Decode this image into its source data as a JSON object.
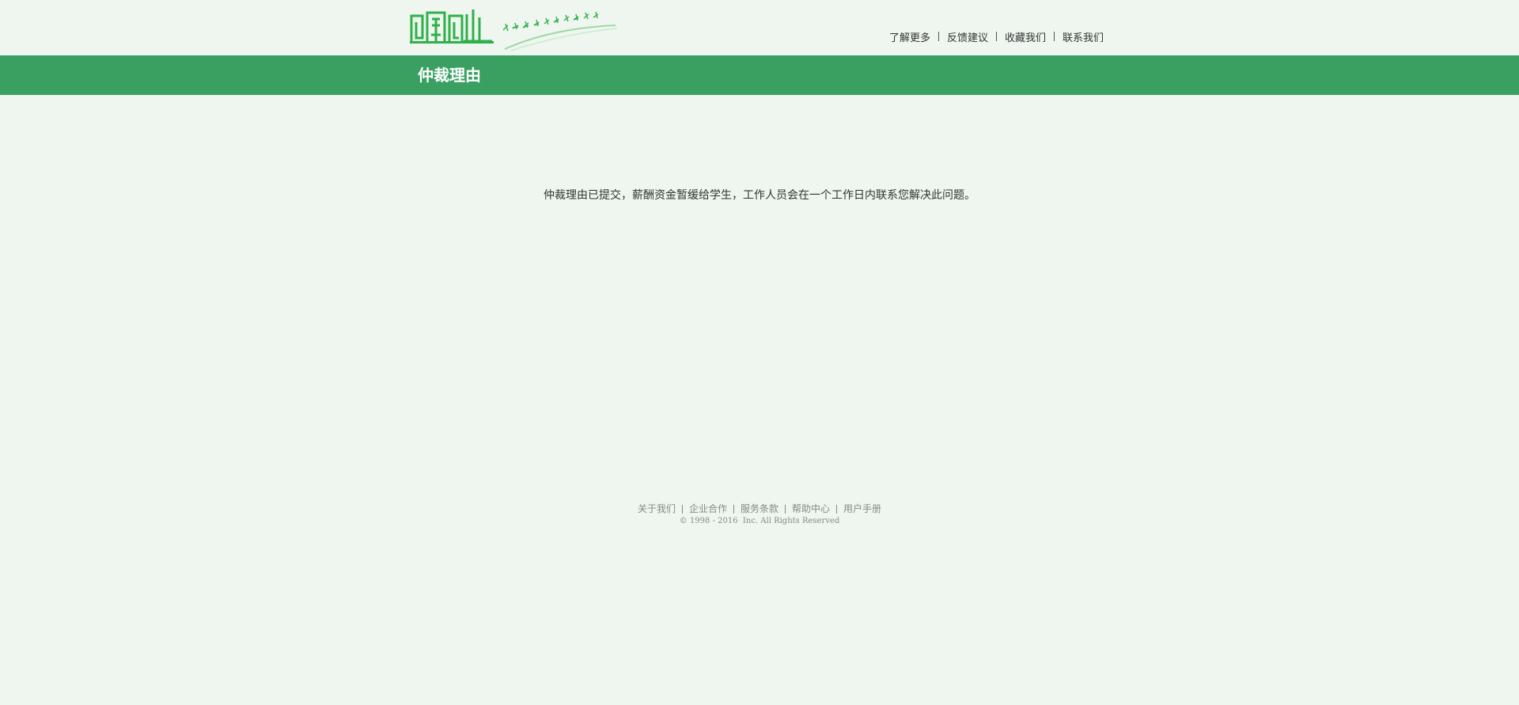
{
  "header": {
    "logo_alt": "logo",
    "nav": [
      {
        "label": "了解更多"
      },
      {
        "label": "反馈建议"
      },
      {
        "label": "收藏我们"
      },
      {
        "label": "联系我们"
      }
    ]
  },
  "title_bar": {
    "title": "仲裁理由"
  },
  "main": {
    "message": "仲裁理由已提交，薪酬资金暂缓给学生，工作人员会在一个工作日内联系您解决此问题。"
  },
  "footer": {
    "links": [
      {
        "label": "关于我们"
      },
      {
        "label": "企业合作"
      },
      {
        "label": "服务条款"
      },
      {
        "label": "帮助中心"
      },
      {
        "label": "用户手册"
      }
    ],
    "copyright": "© 1998 - 2016  Inc. All Rights Reserved"
  },
  "colors": {
    "page_bg": "#eef6ef",
    "title_bar_bg": "#39a062",
    "logo_green": "#2fb04a",
    "text": "#333333",
    "footer_text": "#888888"
  }
}
